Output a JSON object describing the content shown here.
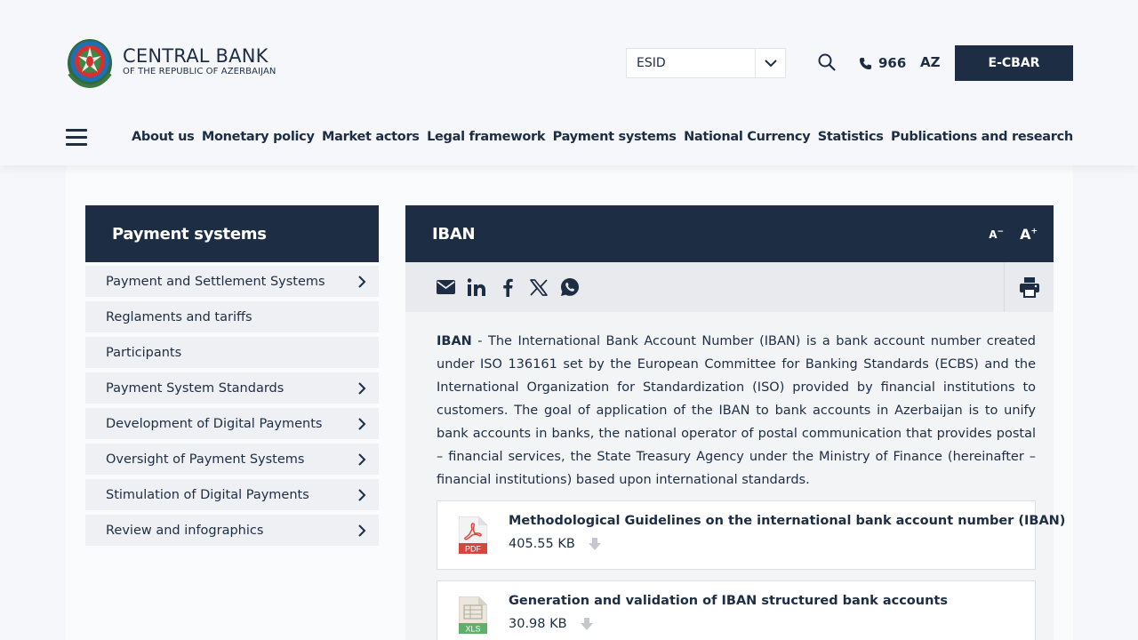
{
  "header": {
    "logo_title": "CENTRAL BANK",
    "logo_subtitle": "OF THE REPUBLIC OF AZERBAIJAN",
    "esid_label": "ESID",
    "phone": "966",
    "language": "AZ",
    "ecbar_label": "E-CBAR"
  },
  "nav": {
    "items": [
      "About us",
      "Monetary policy",
      "Market actors",
      "Legal framework",
      "Payment systems",
      "National Currency",
      "Statistics",
      "Publications and research"
    ]
  },
  "sidebar": {
    "title": "Payment systems",
    "items": [
      {
        "label": "Payment and Settlement Systems",
        "has_children": true
      },
      {
        "label": "Reglaments and tariffs",
        "has_children": false
      },
      {
        "label": "Participants",
        "has_children": false
      },
      {
        "label": "Payment System Standards",
        "has_children": true
      },
      {
        "label": "Development of Digital Payments",
        "has_children": true
      },
      {
        "label": "Oversight of Payment Systems",
        "has_children": true
      },
      {
        "label": "Stimulation of Digital Payments",
        "has_children": true
      },
      {
        "label": "Review and infographics",
        "has_children": true
      }
    ]
  },
  "main": {
    "title": "IBAN",
    "font_decrease": "A",
    "font_increase": "A",
    "intro_term": "IBAN",
    "intro_text": " - The International Bank Account Number (IBAN) is a bank account number created under ISO 136161 set by the European Committee for Banking Standards (ECBS) and the International Organization for Standardization (ISO) provided by financial institutions to customers. The goal of application of the IBAN to bank accounts in Azerbaijan is to unify bank accounts in banks, the national operator of postal communication that provides postal – financial services, the State Treasury Agency under the Ministry of Finance (hereinafter – financial institutions) based upon international standards.",
    "files": [
      {
        "name": "Methodological Guidelines on the international bank account number (IBAN)",
        "size": "405.55 KB",
        "type": "PDF"
      },
      {
        "name": "Generation and validation of IBAN structured bank accounts",
        "size": "30.98 KB",
        "type": "XLS"
      }
    ]
  },
  "colors": {
    "navy": "#1c2d44",
    "pdf_red": "#d9453b",
    "xls_green": "#5fb06b"
  }
}
